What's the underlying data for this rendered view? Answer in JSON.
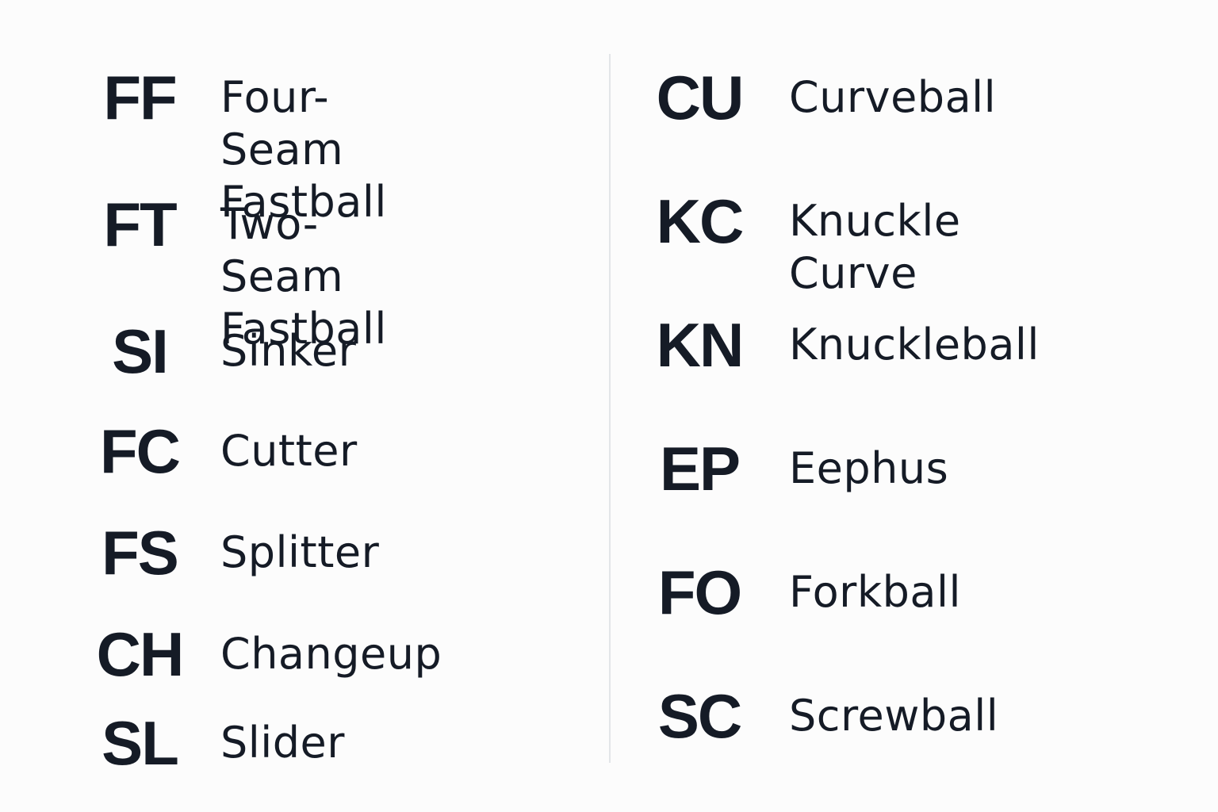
{
  "left_column": [
    {
      "code": "FF",
      "name": "Four-Seam\nFastball"
    },
    {
      "code": "FT",
      "name": "Two-Seam\nFastball"
    },
    {
      "code": "SI",
      "name": "Sinker"
    },
    {
      "code": "FC",
      "name": "Cutter"
    },
    {
      "code": "FS",
      "name": "Splitter"
    },
    {
      "code": "CH",
      "name": "Changeup"
    },
    {
      "code": "SL",
      "name": "Slider"
    }
  ],
  "right_column": [
    {
      "code": "CU",
      "name": "Curveball"
    },
    {
      "code": "KC",
      "name": "Knuckle Curve"
    },
    {
      "code": "KN",
      "name": "Knuckleball"
    },
    {
      "code": "EP",
      "name": "Eephus"
    },
    {
      "code": "FO",
      "name": "Forkball"
    },
    {
      "code": "SC",
      "name": "Screwball"
    }
  ],
  "colors": {
    "text": "#151b26",
    "background": "#fcfcfc",
    "divider": "#e3e5e8"
  }
}
